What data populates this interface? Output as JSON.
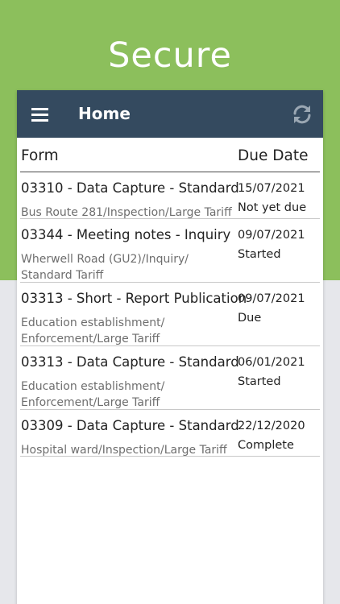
{
  "hero": {
    "title": "Secure"
  },
  "appbar": {
    "title": "Home",
    "menu_icon": "hamburger-menu-icon",
    "refresh_icon": "refresh-icon"
  },
  "table": {
    "columns": [
      "Form",
      "Due Date"
    ],
    "rows": [
      {
        "title": "03310 - Data Capture - Standard",
        "subtitle_lines": [
          "Bus Route 281/Inspection/Large Tariff"
        ],
        "due_date": "15/07/2021",
        "status": "Not yet due"
      },
      {
        "title": "03344 - Meeting notes - Inquiry",
        "subtitle_lines": [
          "Wherwell Road (GU2)/Inquiry/",
          "Standard Tariff"
        ],
        "due_date": "09/07/2021",
        "status": "Started"
      },
      {
        "title": "03313 - Short - Report Publication",
        "subtitle_lines": [
          "Education establishment/",
          "Enforcement/Large Tariff"
        ],
        "due_date": "09/07/2021",
        "status": "Due"
      },
      {
        "title": "03313 - Data Capture - Standard",
        "subtitle_lines": [
          "Education establishment/",
          "Enforcement/Large Tariff"
        ],
        "due_date": "06/01/2021",
        "status": "Started"
      },
      {
        "title": "03309 - Data Capture - Standard",
        "subtitle_lines": [
          "Hospital ward/Inspection/Large Tariff"
        ],
        "due_date": "22/12/2020",
        "status": "Complete"
      }
    ]
  },
  "colors": {
    "header_green": "#8cbf5c",
    "appbar": "#344a5f",
    "page_bg": "#e6e7eb"
  }
}
